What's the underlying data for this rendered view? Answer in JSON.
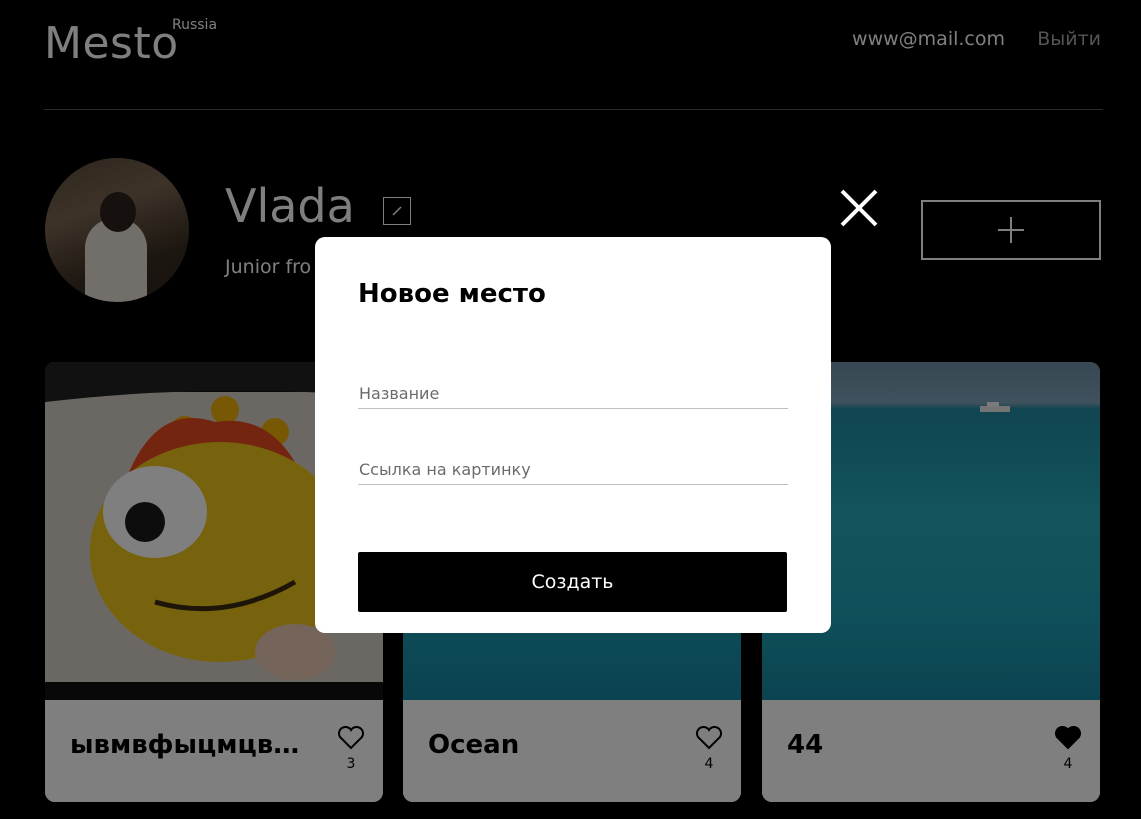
{
  "header": {
    "logo": "Mesto",
    "logo_sup": "Russia",
    "email": "www@mail.com",
    "logout": "Выйти"
  },
  "profile": {
    "name": "Vlada",
    "about": "Junior fro",
    "edit_icon": "pencil-icon",
    "add_icon": "plus-icon"
  },
  "cards": [
    {
      "title": "ывмвфыцмцвф...",
      "likes": "3",
      "liked": false
    },
    {
      "title": "Ocean",
      "likes": "4",
      "liked": false
    },
    {
      "title": "44",
      "likes": "4",
      "liked": true
    }
  ],
  "popup": {
    "title": "Новое место",
    "name_placeholder": "Название",
    "link_placeholder": "Ссылка на картинку",
    "submit": "Создать",
    "close_icon": "close-icon"
  },
  "colors": {
    "background": "#000000",
    "popup_bg": "#ffffff",
    "button_bg": "#000000",
    "logout": "#a9a9a9"
  }
}
